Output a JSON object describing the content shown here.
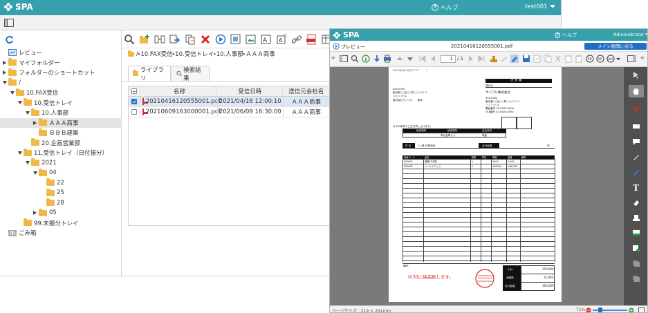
{
  "back_window": {
    "header": {
      "logo": "SPA",
      "help": "ヘルプ",
      "user": "test001"
    },
    "tree": [
      {
        "label": "レビュー",
        "indent": 0,
        "kind": "review"
      },
      {
        "label": "マイフォルダー",
        "indent": 0,
        "kind": "folder",
        "arrow": "right"
      },
      {
        "label": "フォルダーのショートカット",
        "indent": 0,
        "kind": "folder",
        "arrow": "right"
      },
      {
        "label": "/",
        "indent": 0,
        "kind": "folder",
        "arrow": "down"
      },
      {
        "label": "10.FAX受信",
        "indent": 1,
        "kind": "folder",
        "arrow": "down"
      },
      {
        "label": "10.受信トレイ",
        "indent": 2,
        "kind": "folder",
        "arrow": "down"
      },
      {
        "label": "10.人事部",
        "indent": 3,
        "kind": "folder",
        "arrow": "down"
      },
      {
        "label": "ＡＡＡ商事",
        "indent": 4,
        "kind": "folder",
        "arrow": "right",
        "selected": true
      },
      {
        "label": "ＢＢＢ建築",
        "indent": 4,
        "kind": "folder"
      },
      {
        "label": "20.企画営業部",
        "indent": 3,
        "kind": "folder"
      },
      {
        "label": "11.受信トレイ（日付振分）",
        "indent": 2,
        "kind": "folder",
        "arrow": "down"
      },
      {
        "label": "2021",
        "indent": 3,
        "kind": "folder",
        "arrow": "down"
      },
      {
        "label": "04",
        "indent": 4,
        "kind": "folder",
        "arrow": "down"
      },
      {
        "label": "22",
        "indent": 5,
        "kind": "folder"
      },
      {
        "label": "25",
        "indent": 5,
        "kind": "folder"
      },
      {
        "label": "28",
        "indent": 5,
        "kind": "folder"
      },
      {
        "label": "05",
        "indent": 4,
        "kind": "folder",
        "arrow": "right"
      },
      {
        "label": "99.未振分トレイ",
        "indent": 2,
        "kind": "folder"
      },
      {
        "label": "ごみ箱",
        "indent": 0,
        "kind": "trash"
      }
    ],
    "breadcrumb": [
      "/",
      "10.FAX受信",
      "10.受信トレイ",
      "10.人事部",
      "ＡＡＡ商事"
    ],
    "tabs": [
      "ライブラリ",
      "検索結果"
    ],
    "columns": [
      "名称",
      "受信日時",
      "送信元会社名"
    ],
    "rows": [
      {
        "name": "20210416120555001.pdf",
        "date": "2021/04/16 12:00:10",
        "company": "ＡＡＡ商事",
        "checked": true
      },
      {
        "name": "20210609163000001.pdf",
        "date": "2021/06/09 16:30:00",
        "company": "ＡＡＡ商事",
        "checked": false
      }
    ]
  },
  "front_window": {
    "header": {
      "logo": "SPA",
      "help": "ヘルプ",
      "user": "Administrator"
    },
    "preview_label": "プレビュー",
    "file_name": "20210416120555001.pdf",
    "back_button": "メイン画面に戻る",
    "page_current": "1",
    "page_total": "/ 1",
    "footer": {
      "page_size": "ページサイズ：219 × 291mm",
      "zoom": "71%"
    },
    "doc": {
      "fax_header": "2021年4月16日12:03　　　1",
      "title": "注 文 書",
      "order_no_label": "発行日",
      "addr_lines": [
        "000-0000",
        "東京都○○区○○町○○○1-1-1",
        "○○○○ビル",
        "株式会社サンプル　　御中"
      ],
      "vendor_name": "サンプル株式会社",
      "vendor_lines": [
        "000-0000",
        "東京都○○区○○町○○○1-1-1",
        "○○○○ビル",
        "電話番号 03-0000-0000",
        "FAX番号 03-0000-0000"
      ],
      "notice": "以下の条件でご注文申し上げます。",
      "cond_headers": [
        "納品場所",
        "納品場所",
        "支払条件"
      ],
      "cond_values": [
        "本社倉庫ビル",
        "",
        "現金"
      ],
      "subject_label": "件 名",
      "subject_value": "○○県 在庫商品",
      "total_label": "合計金額",
      "total_value": "円",
      "item_headers": [
        "商品コード",
        "品名",
        "数量",
        "単位",
        "単価",
        "金額",
        "備考"
      ],
      "items": [
        [
          "000001",
          "建築CP材料",
          "1",
          "",
          "2000",
          "2,000",
          ""
        ],
        [
          "000002",
          "シールドエッジ",
          "1",
          "",
          "148000",
          "148,000",
          ""
        ]
      ],
      "remarks_label": "備考：",
      "handwritten": "6/30に納品致します。",
      "stamp_date": "2021/04/26",
      "sum_labels": [
        "小計",
        "消費税",
        "合計金額"
      ],
      "sum_values": [
        "150,000",
        "15,000",
        "165,000"
      ]
    }
  },
  "colors": {
    "header": "#36a0ad",
    "selection": "#dde8f5",
    "folder": "#f0b84a",
    "back_button": "#1e6fc8"
  }
}
